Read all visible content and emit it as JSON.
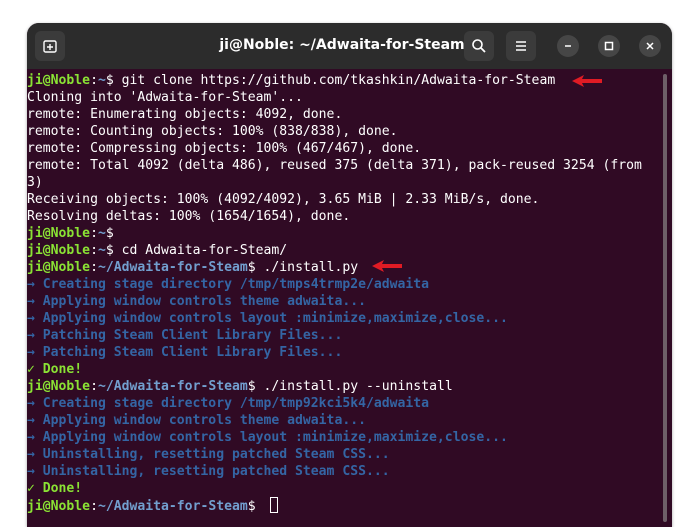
{
  "window": {
    "title": "ji@Noble: ~/Adwaita-for-Steam"
  },
  "icons": {
    "new_tab": "new-tab-icon",
    "search": "search-icon",
    "menu": "hamburger-menu-icon",
    "minimize": "minimize-icon",
    "maximize": "maximize-icon",
    "close": "close-icon",
    "annotation": "red-arrow-icon"
  },
  "colors": {
    "background": "#300a24",
    "titlebar": "#2c2c2c",
    "prompt_user": "#8ae234",
    "prompt_path": "#729fcf",
    "info": "#3465a4",
    "annotation_arrow": "#e01b24"
  },
  "terminal": {
    "lines": [
      {
        "user": "ji@Noble",
        "path": "~",
        "cmd": "git clone https://github.com/tkashkin/Adwaita-for-Steam"
      },
      {
        "text": "Cloning into 'Adwaita-for-Steam'..."
      },
      {
        "text": "remote: Enumerating objects: 4092, done."
      },
      {
        "text": "remote: Counting objects: 100% (838/838), done."
      },
      {
        "text": "remote: Compressing objects: 100% (467/467), done."
      },
      {
        "text": "remote: Total 4092 (delta 486), reused 375 (delta 371), pack-reused 3254 (from"
      },
      {
        "text": "3)"
      },
      {
        "text": "Receiving objects: 100% (4092/4092), 3.65 MiB | 2.33 MiB/s, done."
      },
      {
        "text": "Resolving deltas: 100% (1654/1654), done."
      },
      {
        "user": "ji@Noble",
        "path": "~",
        "cmd": ""
      },
      {
        "user": "ji@Noble",
        "path": "~",
        "cmd": "cd Adwaita-for-Steam/"
      },
      {
        "user": "ji@Noble",
        "path": "~/Adwaita-for-Steam",
        "cmd": "./install.py"
      },
      {
        "info": "→ Creating stage directory /tmp/tmps4trmp2e/adwaita"
      },
      {
        "info": "→ Applying window controls theme adwaita..."
      },
      {
        "info": "→ Applying window controls layout :minimize,maximize,close..."
      },
      {
        "info": "→ Patching Steam Client Library Files..."
      },
      {
        "info": "→ Patching Steam Client Library Files..."
      },
      {
        "ok": "✓ Done!"
      },
      {
        "user": "ji@Noble",
        "path": "~/Adwaita-for-Steam",
        "cmd": "./install.py --uninstall"
      },
      {
        "info": "→ Creating stage directory /tmp/tmp92kci5k4/adwaita"
      },
      {
        "info": "→ Applying window controls theme adwaita..."
      },
      {
        "info": "→ Applying window controls layout :minimize,maximize,close..."
      },
      {
        "info": "→ Uninstalling, resetting patched Steam CSS..."
      },
      {
        "info": "→ Uninstalling, resetting patched Steam CSS..."
      },
      {
        "ok": "✓ Done!"
      },
      {
        "user": "ji@Noble",
        "path": "~/Adwaita-for-Steam",
        "cmd": "",
        "cursor": true
      }
    ]
  }
}
